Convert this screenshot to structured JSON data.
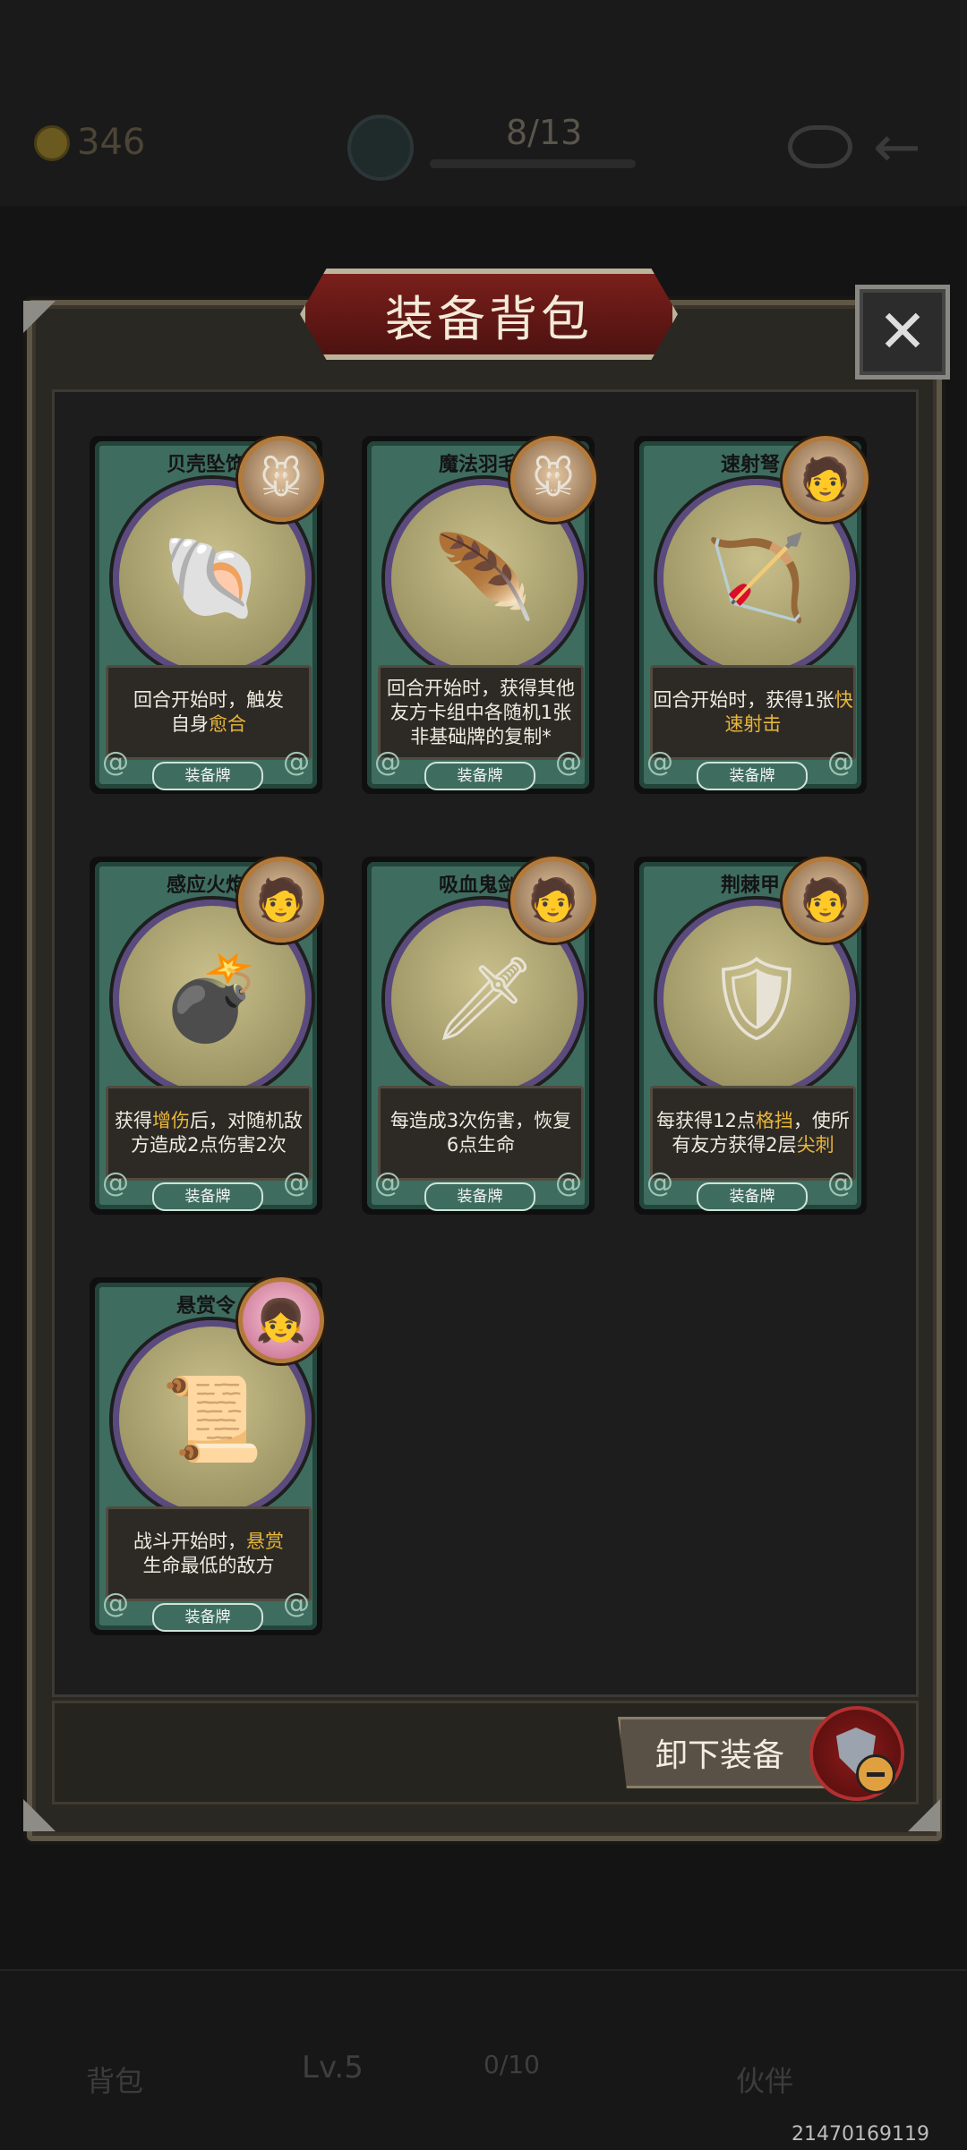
{
  "background_hud": {
    "gold": "346",
    "progress": "8/13",
    "level": "Lv.5",
    "exp": "0/10",
    "bag_label": "背包",
    "pet_label": "伙伴"
  },
  "dialog": {
    "title": "装备背包",
    "close_icon": "close-icon",
    "unequip_label": "卸下装备"
  },
  "cards": [
    {
      "name": "贝壳坠饰",
      "desc_parts": [
        "回合开始时，触发",
        "自身",
        "愈合"
      ],
      "tag": "装备牌"
    },
    {
      "name": "魔法羽毛",
      "desc_parts": [
        "回合开始时，获得其他友方卡组中各随机1张非基础牌的复制*"
      ],
      "tag": "装备牌"
    },
    {
      "name": "速射弩",
      "desc_parts": [
        "回合开始时，获得1张",
        "快速射击"
      ],
      "tag": "装备牌"
    },
    {
      "name": "感应火炮",
      "desc_parts": [
        "获得",
        "增伤",
        "后，对随机敌方造成2点伤害2次"
      ],
      "tag": "装备牌"
    },
    {
      "name": "吸血鬼剑",
      "desc_parts": [
        "每造成3次伤害，恢复6点生命"
      ],
      "tag": "装备牌"
    },
    {
      "name": "荆棘甲",
      "desc_parts": [
        "每获得12点",
        "格挡",
        "，使所有友方获得2层",
        "尖刺"
      ],
      "tag": "装备牌"
    },
    {
      "name": "悬赏令",
      "desc_parts": [
        "战斗开始时，",
        "悬赏",
        "生命最低的敌方"
      ],
      "tag": "装备牌"
    }
  ],
  "watermark": "21470169119",
  "colors": {
    "highlight": "#e8b63a",
    "card_frame": "#3e6d5f",
    "title_banner": "#7a1f1b"
  }
}
